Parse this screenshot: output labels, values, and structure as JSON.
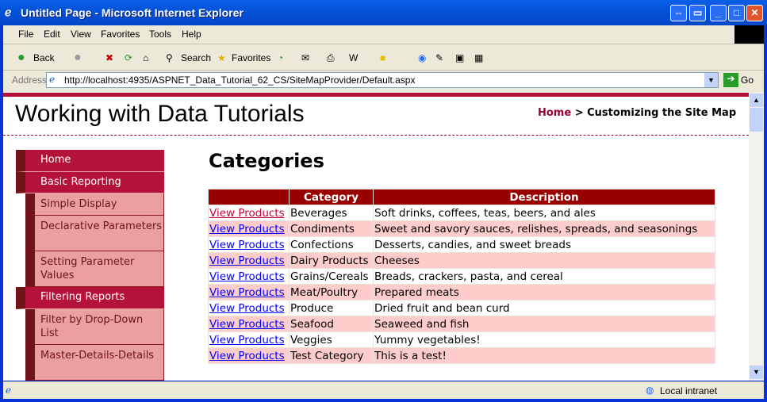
{
  "window": {
    "title": "Untitled Page - Microsoft Internet Explorer"
  },
  "menubar": [
    "File",
    "Edit",
    "View",
    "Favorites",
    "Tools",
    "Help"
  ],
  "toolbar": {
    "back": "Back",
    "search": "Search",
    "favorites": "Favorites"
  },
  "address": {
    "label": "Address",
    "url": "http://localhost:4935/ASPNET_Data_Tutorial_62_CS/SiteMapProvider/Default.aspx",
    "go": "Go"
  },
  "site": {
    "title": "Working with Data Tutorials",
    "breadcrumb": {
      "home": "Home",
      "separator": " > ",
      "current": "Customizing the Site Map"
    }
  },
  "nav": [
    {
      "label": "Home",
      "level": 0
    },
    {
      "label": "Basic Reporting",
      "level": 0
    },
    {
      "label": "Simple Display",
      "level": 1
    },
    {
      "label": "Declarative Parameters",
      "level": 1
    },
    {
      "label": "Setting Parameter Values",
      "level": 1
    },
    {
      "label": "Filtering Reports",
      "level": 0
    },
    {
      "label": "Filter by Drop-Down List",
      "level": 1
    },
    {
      "label": "Master-Details-Details",
      "level": 1
    }
  ],
  "main": {
    "heading": "Categories",
    "table": {
      "headers": [
        "",
        "Category",
        "Description"
      ],
      "link_label": "View Products",
      "rows": [
        [
          "Beverages",
          "Soft drinks, coffees, teas, beers, and ales"
        ],
        [
          "Condiments",
          "Sweet and savory sauces, relishes, spreads, and seasonings"
        ],
        [
          "Confections",
          "Desserts, candies, and sweet breads"
        ],
        [
          "Dairy Products",
          "Cheeses"
        ],
        [
          "Grains/Cereals",
          "Breads, crackers, pasta, and cereal"
        ],
        [
          "Meat/Poultry",
          "Prepared meats"
        ],
        [
          "Produce",
          "Dried fruit and bean curd"
        ],
        [
          "Seafood",
          "Seaweed and fish"
        ],
        [
          "Veggies",
          "Yummy vegetables!"
        ],
        [
          "Test Category",
          "This is a test!"
        ]
      ]
    }
  },
  "status": {
    "zone": "Local intranet"
  }
}
